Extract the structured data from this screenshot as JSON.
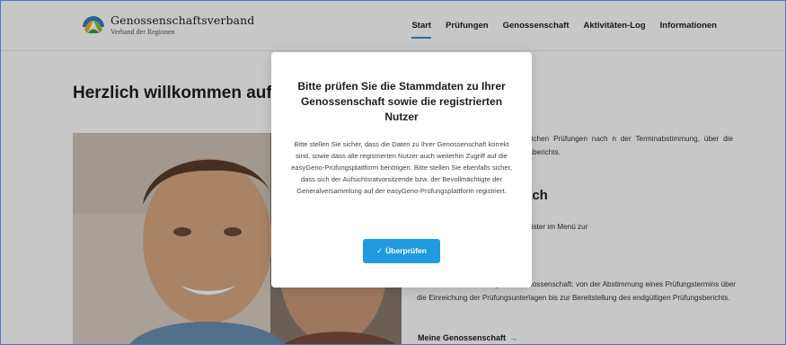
{
  "brand": {
    "name": "Genossenschaftsverband",
    "subtitle": "Verband der Regionen"
  },
  "nav": [
    "Start",
    "Prüfungen",
    "Genossenschaft",
    "Aktivitäten-Log",
    "Informationen"
  ],
  "nav_active": "Start",
  "page": {
    "title": "Herzlich willkommen auf d",
    "paragraph1": "tform organisieren wir die gesetzlichen Prüfungen nach n der Terminabstimmung, über die Einreichung der ittlung des Prüfungsberichts.",
    "heading2": "fach",
    "paragraph2": "n hier über die entsprechenden Register im Menü zur",
    "paragraph3": "über die aktuelle Prüfung Ihrer Genossenschaft: von der Abstimmung eines Prüfungstermins über die Einreichung der Prüfungsunterlagen bis zur Bereitstellung des endgültigen Prüfungsberichts.",
    "link_label": "Meine Genossenschaft",
    "link_arrow": "→"
  },
  "modal": {
    "title": "Bitte prüfen Sie die Stammdaten zu Ihrer Genossenschaft sowie die registrierten Nutzer",
    "body": "Bitte stellen Sie sicher, dass die Daten zu Ihrer Genossenschaft korrekt sind, sowie dass alle registrierten Nutzer auch weiterhin Zugriff auf die easyGeno-Prüfungsplattform benötigen. Bitte stellen Sie ebenfalls sicher, dass sich der Aufsichtsratvorsitzende bzw. der Bevollmächtigte der Generalversammlung auf der easyGeno-Prüfungsplattform registriert.",
    "button_label": "Überprüfen",
    "button_icon": "✓"
  },
  "colors": {
    "accent": "#1f9be0",
    "nav_underline": "#2f8fd1",
    "overlay": "rgba(0,0,0,0.22)"
  }
}
